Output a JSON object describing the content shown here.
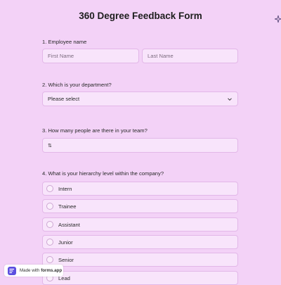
{
  "form": {
    "title": "360 Degree Feedback Form",
    "q1": {
      "label": "1.  Employee name",
      "first_placeholder": "First Name",
      "last_placeholder": "Last Name"
    },
    "q2": {
      "label": "2. Which is your department?",
      "selected": "Please select"
    },
    "q3": {
      "label": "3. How many people are there in your team?",
      "stepper_symbol": "⇅"
    },
    "q4": {
      "label": "4. What is your hierarchy level within the company?",
      "options": [
        "Intern",
        "Trainee",
        "Assistant",
        "Junior",
        "Senior",
        "Lead"
      ]
    }
  },
  "badge": {
    "prefix": "Made with",
    "brand": "forms.app"
  },
  "icons": {
    "sparkle": "sparkle-icon",
    "chevron": "chevron-down-icon",
    "logo": "forms-app-logo-icon"
  },
  "colors": {
    "background": "#f3d2f7",
    "field_bg": "#f8e4fb",
    "field_border": "#e2b7e8"
  }
}
